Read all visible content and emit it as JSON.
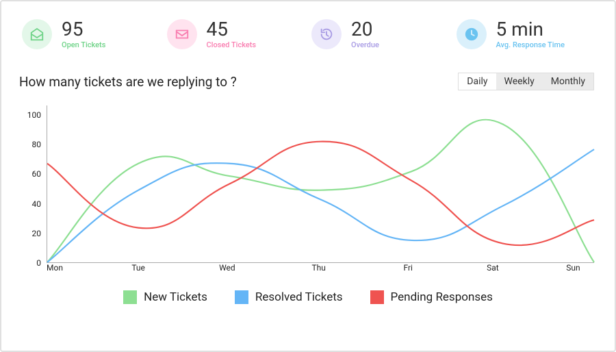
{
  "stats": {
    "open": {
      "value": "95",
      "label": "Open Tickets",
      "color": "#6fd388"
    },
    "closed": {
      "value": "45",
      "label": "Closed Tickets",
      "color": "#f97eb0"
    },
    "overdue": {
      "value": "20",
      "label": "Overdue",
      "color": "#a89be4"
    },
    "avg": {
      "value": "5 min",
      "label": "Avg. Response Time",
      "color": "#6ac3f0"
    }
  },
  "chart_title": "How many tickets are we replying to ?",
  "toggle": {
    "daily": "Daily",
    "weekly": "Weekly",
    "monthly": "Monthly",
    "active": "daily"
  },
  "legend": {
    "new": {
      "label": "New Tickets",
      "color": "#8ddf92"
    },
    "resolved": {
      "label": "Resolved Tickets",
      "color": "#64b5f6"
    },
    "pending": {
      "label": "Pending Responses",
      "color": "#ef5350"
    }
  },
  "chart_data": {
    "type": "line",
    "title": "How many tickets are we replying to ?",
    "xlabel": "",
    "ylabel": "",
    "ylim": [
      0,
      100
    ],
    "y_ticks": [
      0,
      20,
      40,
      60,
      80,
      100
    ],
    "categories": [
      "Mon",
      "Tue",
      "Wed",
      "Thu",
      "Fri",
      "Sat",
      "Sun"
    ],
    "series": [
      {
        "name": "New Tickets",
        "color": "#8ddf92",
        "values": [
          0,
          63,
          55,
          46,
          58,
          88,
          0
        ]
      },
      {
        "name": "Resolved Tickets",
        "color": "#64b5f6",
        "values": [
          0,
          46,
          63,
          40,
          14,
          36,
          72
        ]
      },
      {
        "name": "Pending Responses",
        "color": "#ef5350",
        "values": [
          63,
          22,
          50,
          77,
          52,
          12,
          27
        ]
      }
    ]
  }
}
